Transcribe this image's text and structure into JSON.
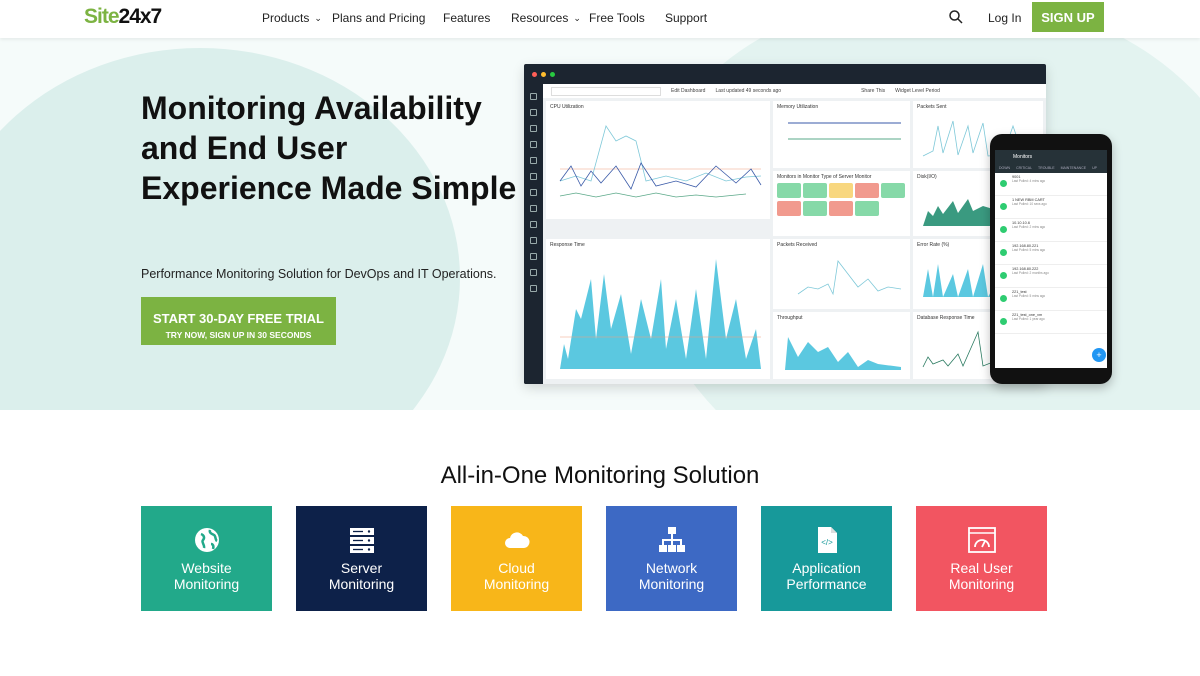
{
  "nav": {
    "logo_a": "Site",
    "logo_b": "24x7",
    "items": [
      {
        "label": "Products",
        "dropdown": true
      },
      {
        "label": "Plans and Pricing"
      },
      {
        "label": "Features"
      },
      {
        "label": "Resources",
        "dropdown": true
      },
      {
        "label": "Free Tools"
      },
      {
        "label": "Support"
      }
    ],
    "search_icon": "search-icon",
    "login": "Log In",
    "signup": "SIGN UP"
  },
  "hero": {
    "title": "Monitoring Availability and End User Experience Made Simple",
    "subtitle": "Performance Monitoring Solution for DevOps and IT Operations.",
    "cta_main": "START 30-DAY FREE TRIAL",
    "cta_sub": "TRY NOW, SIGN UP IN 30 SECONDS"
  },
  "dashboard": {
    "edit": "Edit Dashboard",
    "updated": "Last updated 49 seconds ago",
    "share": "Share This",
    "period": "Widget Level Period",
    "widgets": [
      "CPU Utilization",
      "Memory Utilization",
      "Packets Sent",
      "Monitors in Monitor Type of Server Monitor",
      "Disk(I/O)",
      "Response Time",
      "Packets Received",
      "Error Rate (%)",
      "Throughput",
      "Database Response Time"
    ],
    "tiles": [
      "up",
      "up",
      "trouble",
      "down",
      "up",
      "down",
      "up",
      "down",
      "up"
    ]
  },
  "phone": {
    "title": "Monitors",
    "tabs": [
      "DOWN",
      "CRITICAL",
      "TROUBLE",
      "MAINTENANCE",
      "UP"
    ],
    "items": [
      {
        "name": "9001",
        "info": "Last Polled: 4 mins ago"
      },
      {
        "name": "1 NEW RBM CART",
        "info": "Last Polled: 10 secs ago"
      },
      {
        "name": "10.10.10.6",
        "info": "Last Polled: 2 mins ago"
      },
      {
        "name": "192.168.80.221",
        "info": "Last Polled: 5 mins ago"
      },
      {
        "name": "192.168.80.222",
        "info": "Last Polled: 2 months ago"
      },
      {
        "name": "221_test",
        "info": "Last Polled: 5 mins ago"
      },
      {
        "name": "221_test_one_vm",
        "info": "Last Polled: 1 year ago"
      }
    ]
  },
  "section": {
    "title": "All-in-One Monitoring Solution",
    "cards": [
      {
        "l1": "Website",
        "l2": "Monitoring",
        "color": "#22a98a",
        "icon": "globe-icon"
      },
      {
        "l1": "Server",
        "l2": "Monitoring",
        "color": "#0d2149",
        "icon": "server-icon"
      },
      {
        "l1": "Cloud",
        "l2": "Monitoring",
        "color": "#f8b619",
        "icon": "cloud-icon"
      },
      {
        "l1": "Network",
        "l2": "Monitoring",
        "color": "#3d69c4",
        "icon": "network-icon"
      },
      {
        "l1": "Application",
        "l2": "Performance",
        "color": "#17999a",
        "icon": "code-file-icon"
      },
      {
        "l1": "Real User",
        "l2": "Monitoring",
        "color": "#f25561",
        "icon": "speedometer-icon"
      }
    ]
  }
}
